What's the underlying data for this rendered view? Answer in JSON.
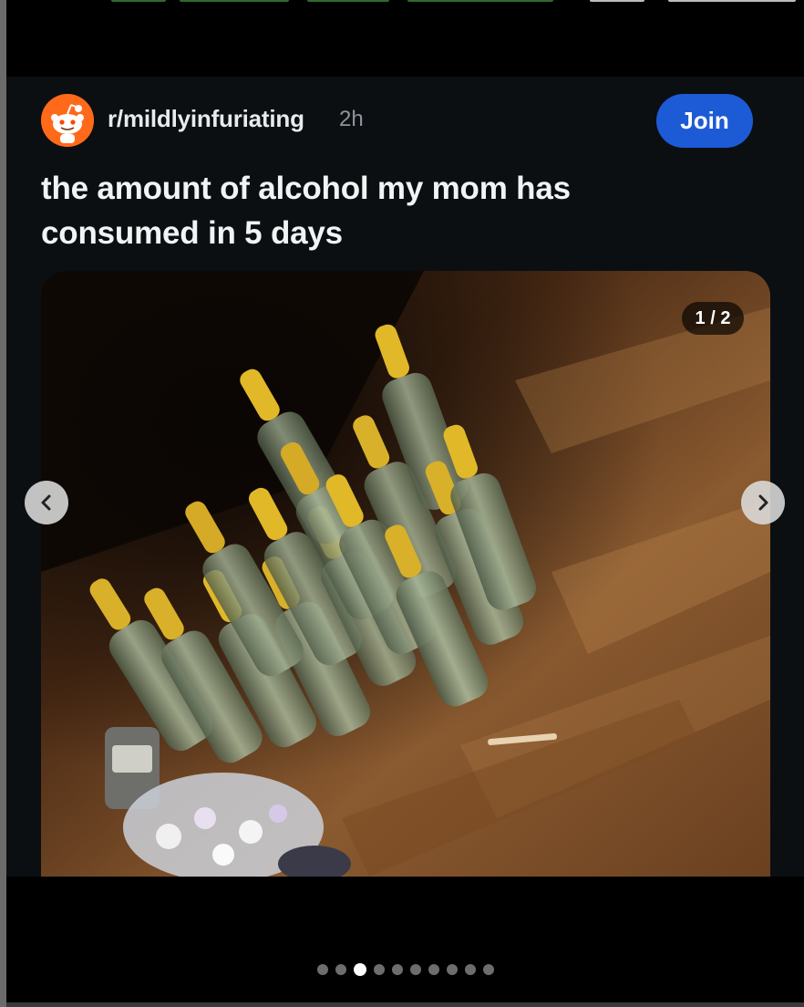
{
  "post": {
    "subreddit": "r/mildlyinfuriating",
    "age": "2h",
    "join_label": "Join",
    "title": "the amount of alcohol my mom has consumed in 5 days"
  },
  "media": {
    "counter": "1 / 2",
    "description_icon": "photo-icon"
  },
  "carousel": {
    "dot_count": 10,
    "active_index": 2
  },
  "colors": {
    "join": "#1d5bd6",
    "avatar": "#ff6a1a",
    "card_bg": "#0b0f12"
  }
}
